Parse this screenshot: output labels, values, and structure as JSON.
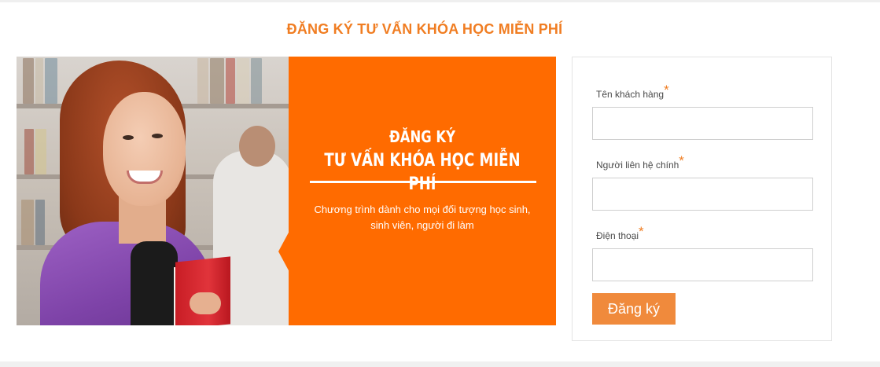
{
  "section": {
    "title": "ĐĂNG KÝ TƯ VẤN KHÓA HỌC MIỄN PHÍ"
  },
  "banner": {
    "heading_line1": "ĐĂNG KÝ",
    "heading_line2": "TƯ VẤN KHÓA HỌC MIỄN PHÍ",
    "description_line1": "Chương trình dành cho mọi đối tượng học sinh,",
    "description_line2": "sinh viên, người đi làm",
    "accent_color": "#ff6b00"
  },
  "form": {
    "fields": [
      {
        "label": "Tên khách hàng",
        "required_mark": "*",
        "value": ""
      },
      {
        "label": "Người liên hệ chính",
        "required_mark": "*",
        "value": ""
      },
      {
        "label": "Điện thoại",
        "required_mark": "*",
        "value": ""
      }
    ],
    "submit_label": "Đăng ký",
    "button_color": "#f08a3c"
  }
}
